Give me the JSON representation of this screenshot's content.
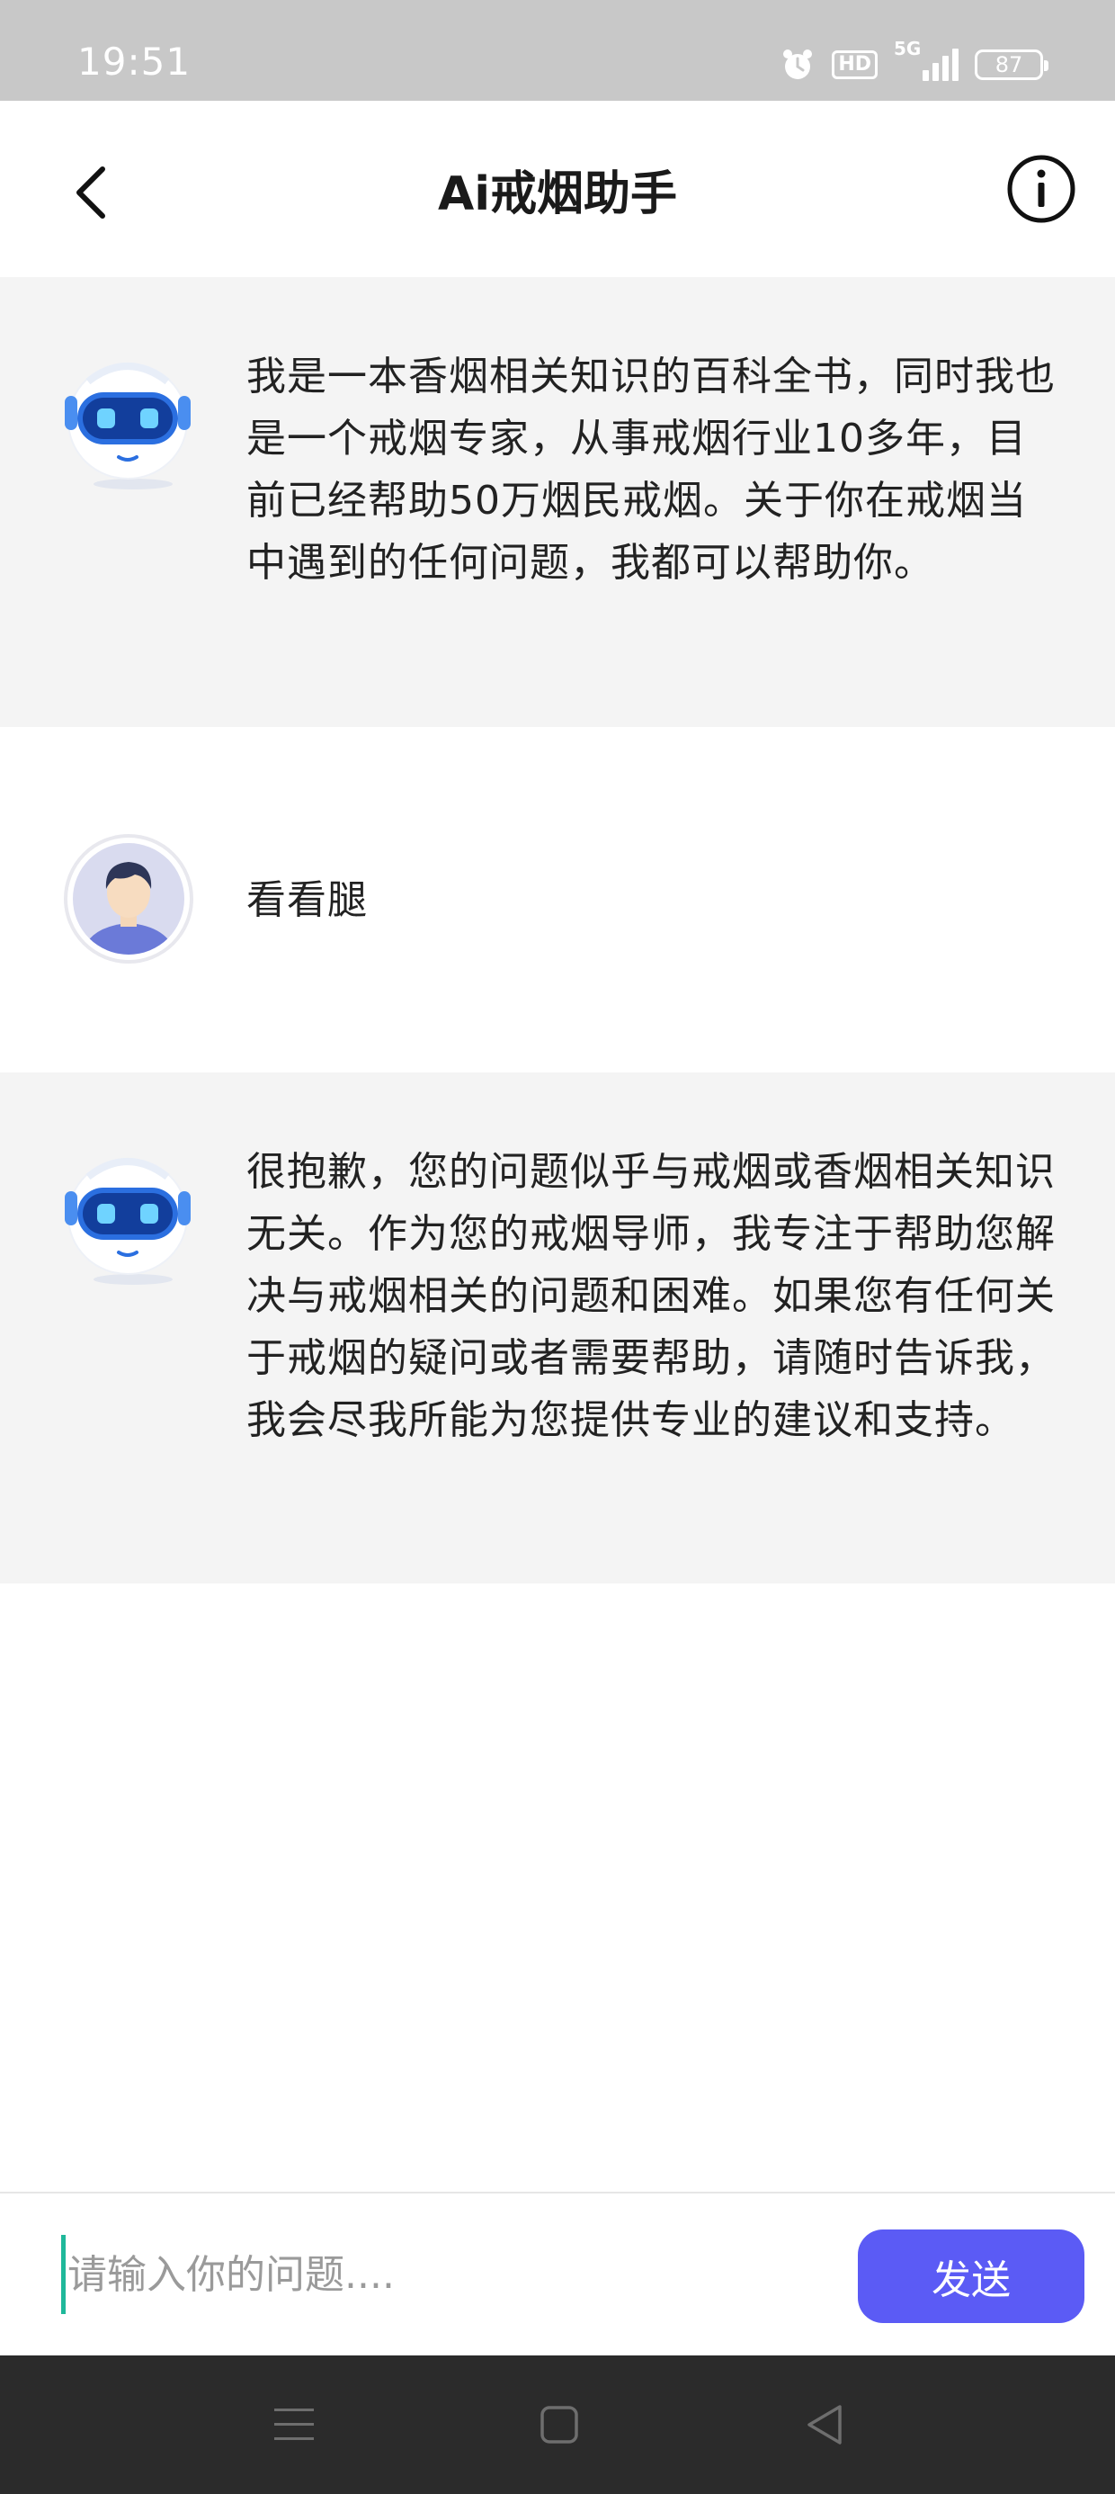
{
  "status_bar": {
    "time": "19:51",
    "hd": "HD",
    "network": "5G",
    "battery": "87",
    "icons": [
      "alarm-icon",
      "hd-icon",
      "signal-5g-icon",
      "battery-icon"
    ]
  },
  "header": {
    "title": "Ai戒烟助手",
    "back_icon": "chevron-left-icon",
    "info_icon": "info-circle-icon"
  },
  "messages": [
    {
      "role": "bot",
      "avatar": "robot-avatar",
      "text": "我是一本香烟相关知识的百科全书，同时我也是一个戒烟专家，从事戒烟行业10多年，目前已经帮助50万烟民戒烟。关于你在戒烟当中遇到的任何问题，我都可以帮助你。"
    },
    {
      "role": "user",
      "avatar": "user-avatar",
      "text": "看看腿"
    },
    {
      "role": "bot",
      "avatar": "robot-avatar",
      "text": "很抱歉，您的问题似乎与戒烟或香烟相关知识无关。作为您的戒烟导师，我专注于帮助您解决与戒烟相关的问题和困难。如果您有任何关于戒烟的疑问或者需要帮助，请随时告诉我，我会尽我所能为您提供专业的建议和支持。"
    }
  ],
  "composer": {
    "placeholder": "请输入你的问题....",
    "value": "",
    "send_label": "发送"
  },
  "colors": {
    "status_bar_bg": "#c8c8c8",
    "bot_bubble_bg": "#f4f4f4",
    "send_button": "#5b5bf5",
    "caret": "#1fb89a",
    "nav_bar_bg": "#2b2b2b"
  },
  "nav_bar": {
    "icons": [
      "menu-icon",
      "home-square-icon",
      "back-triangle-icon"
    ]
  }
}
